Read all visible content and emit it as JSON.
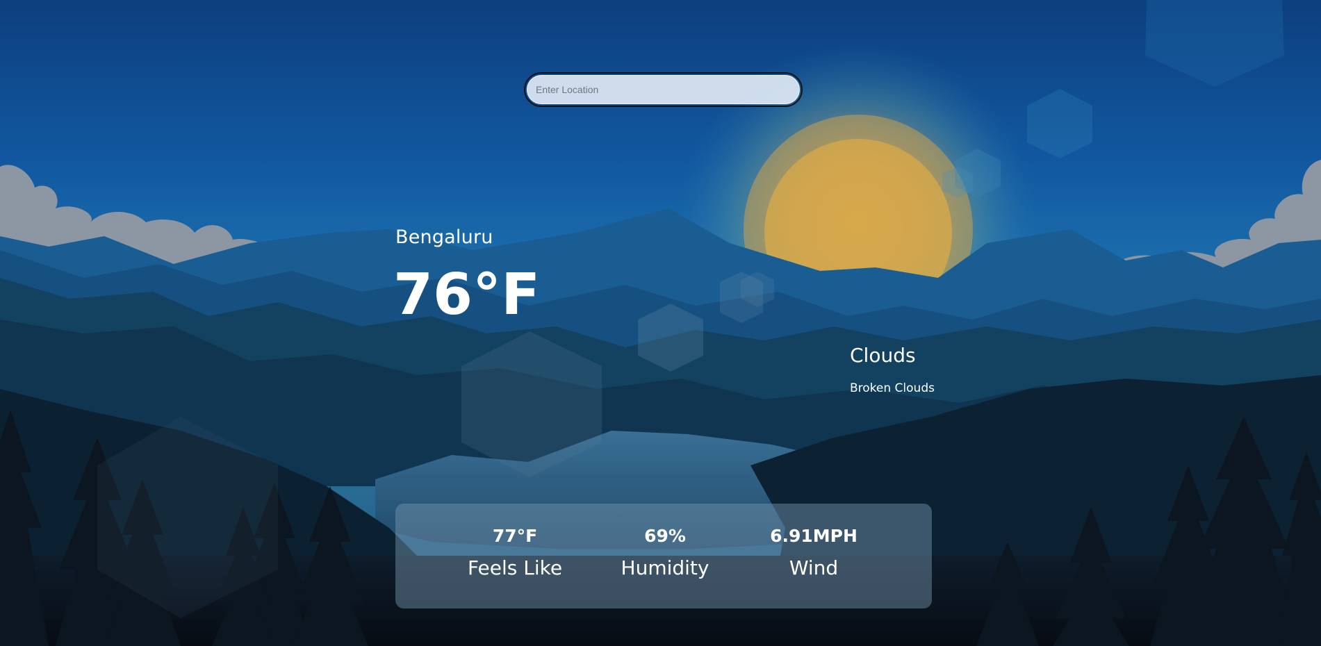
{
  "search": {
    "placeholder": "Enter Location",
    "value": ""
  },
  "current": {
    "location": "Bengaluru",
    "temperature": "76°F",
    "condition": "Clouds",
    "description": "Broken Clouds"
  },
  "stats": {
    "feels_like": {
      "value": "77°F",
      "label": "Feels Like"
    },
    "humidity": {
      "value": "69%",
      "label": "Humidity"
    },
    "wind": {
      "value": "6.91MPH",
      "label": "Wind"
    }
  },
  "colors": {
    "sky_top": "#0f4e93",
    "sky_mid": "#1a69a6",
    "sun": "#d8a84a",
    "mountain_far": "#1e5f98",
    "mountain_mid": "#0f3e62",
    "mountain_near": "#0b2638",
    "forest": "#0a1520",
    "panel": "#6d8aa3"
  }
}
